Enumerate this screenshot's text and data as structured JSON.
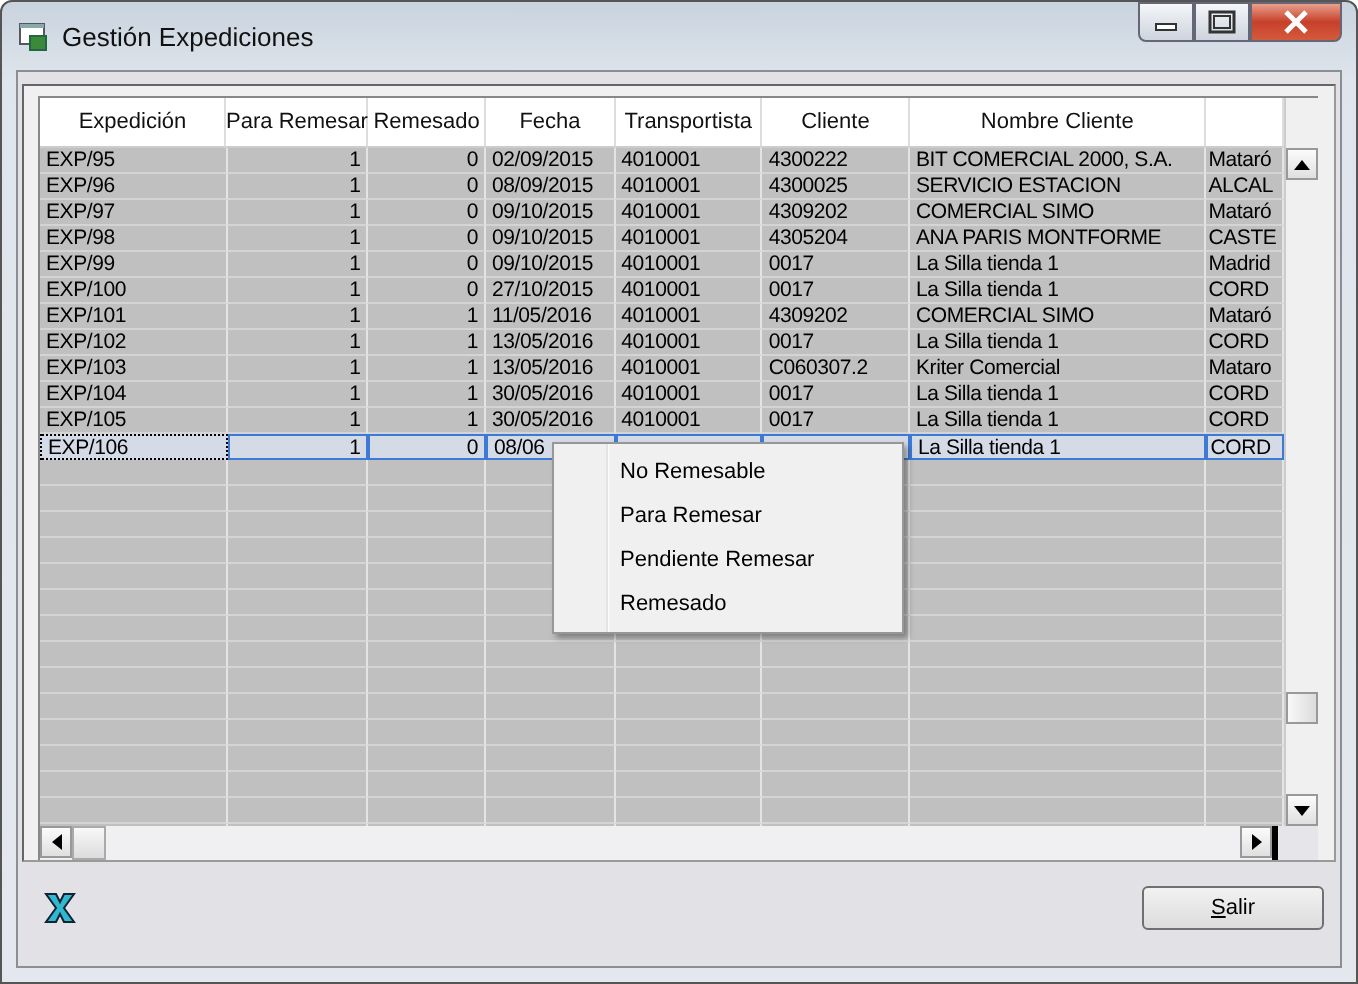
{
  "window": {
    "title": "Gestión Expediciones"
  },
  "table": {
    "columns": [
      "Expedición",
      "Para Remesar",
      "Remesado",
      "Fecha",
      "Transportista",
      "Cliente",
      "Nombre Cliente",
      ""
    ],
    "rows": [
      {
        "selected": false,
        "cells": [
          "EXP/95",
          "1",
          "0",
          "02/09/2015",
          "4010001",
          "4300222",
          "BIT COMERCIAL 2000, S.A.",
          "Mataró"
        ]
      },
      {
        "selected": false,
        "cells": [
          "EXP/96",
          "1",
          "0",
          "08/09/2015",
          "4010001",
          "4300025",
          "SERVICIO ESTACION",
          "ALCAL"
        ]
      },
      {
        "selected": false,
        "cells": [
          "EXP/97",
          "1",
          "0",
          "09/10/2015",
          "4010001",
          "4309202",
          "COMERCIAL SIMO",
          "Mataró"
        ]
      },
      {
        "selected": false,
        "cells": [
          "EXP/98",
          "1",
          "0",
          "09/10/2015",
          "4010001",
          "4305204",
          "ANA PARIS MONTFORME",
          "CASTE"
        ]
      },
      {
        "selected": false,
        "cells": [
          "EXP/99",
          "1",
          "0",
          "09/10/2015",
          "4010001",
          "0017",
          "La Silla tienda 1",
          "Madrid"
        ]
      },
      {
        "selected": false,
        "cells": [
          "EXP/100",
          "1",
          "0",
          "27/10/2015",
          "4010001",
          "0017",
          "La Silla tienda 1",
          "CORD"
        ]
      },
      {
        "selected": false,
        "cells": [
          "EXP/101",
          "1",
          "1",
          "11/05/2016",
          "4010001",
          "4309202",
          "COMERCIAL SIMO",
          "Mataró"
        ]
      },
      {
        "selected": false,
        "cells": [
          "EXP/102",
          "1",
          "1",
          "13/05/2016",
          "4010001",
          "0017",
          "La Silla tienda 1",
          "CORD"
        ]
      },
      {
        "selected": false,
        "cells": [
          "EXP/103",
          "1",
          "1",
          "13/05/2016",
          "4010001",
          "C060307.2",
          "Kriter Comercial",
          "Mataro"
        ]
      },
      {
        "selected": false,
        "cells": [
          "EXP/104",
          "1",
          "1",
          "30/05/2016",
          "4010001",
          "0017",
          "La Silla tienda 1",
          "CORD"
        ]
      },
      {
        "selected": false,
        "cells": [
          "EXP/105",
          "1",
          "1",
          "30/05/2016",
          "4010001",
          "0017",
          "La Silla tienda 1",
          "CORD"
        ]
      },
      {
        "selected": true,
        "cells": [
          "EXP/106",
          "1",
          "0",
          "08/06",
          "",
          "",
          "La Silla tienda 1",
          "CORD"
        ]
      }
    ]
  },
  "context_menu": {
    "items": [
      "No Remesable",
      "Para Remesar",
      "Pendiente Remesar",
      "Remesado"
    ]
  },
  "buttons": [
    "Salir"
  ]
}
